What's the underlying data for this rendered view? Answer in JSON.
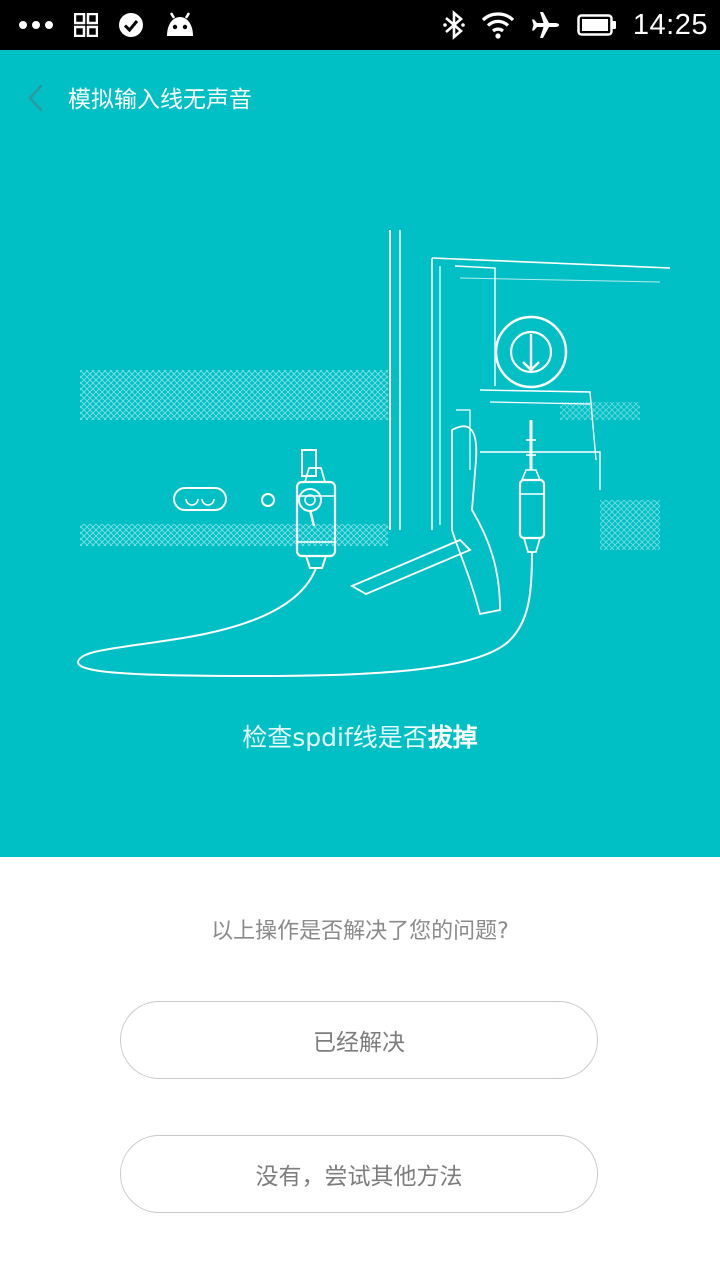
{
  "status_bar": {
    "time": "14:25",
    "left_icons": [
      "more-dots-icon",
      "apps-grid-icon",
      "check-circle-icon",
      "android-icon"
    ],
    "right_icons": [
      "bluetooth-icon",
      "wifi-icon",
      "airplane-mode-icon",
      "battery-icon"
    ]
  },
  "header": {
    "back_icon": "chevron-left-icon",
    "title": "模拟输入线无声音"
  },
  "step": {
    "caption_prefix": "检查spdif线是否",
    "caption_emphasis": "拔掉"
  },
  "feedback": {
    "question": "以上操作是否解决了您的问题?",
    "solved_label": "已经解决",
    "try_other_label": "没有，尝试其他方法"
  },
  "colors": {
    "hero_background": "#00c0c6",
    "line_art": "#ffffff",
    "button_border": "#c9c9c9",
    "button_text": "#7d7d7d"
  }
}
